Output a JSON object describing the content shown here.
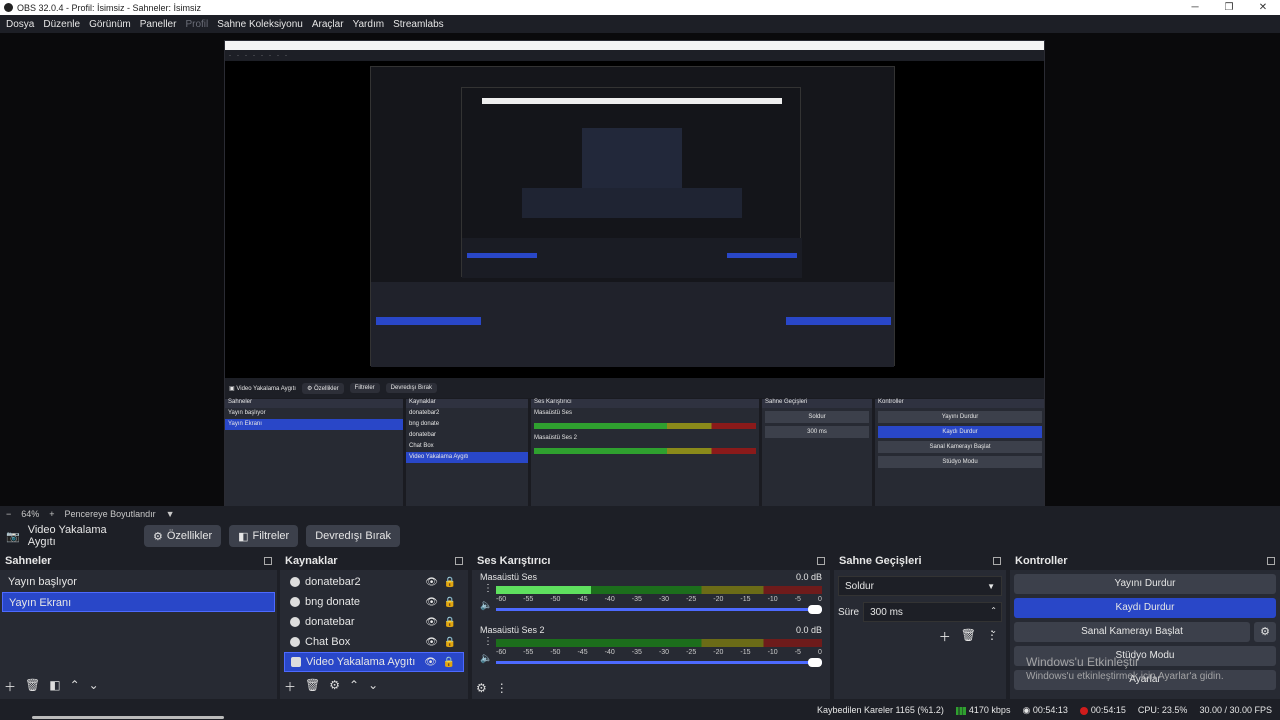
{
  "window": {
    "title": "OBS 32.0.4 - Profil: İsimsiz - Sahneler: İsimsiz"
  },
  "menu": [
    "Dosya",
    "Düzenle",
    "Görünüm",
    "Paneller",
    "Profil",
    "Sahne Koleksiyonu",
    "Araçlar",
    "Yardım",
    "Streamlabs"
  ],
  "zoom": {
    "minus": "−",
    "value": "64%",
    "plus": "+",
    "fit_label": "Pencereye Boyutlandır"
  },
  "source_bar": {
    "source_name": "Video Yakalama Aygıtı",
    "properties": "Özellikler",
    "filters": "Filtreler",
    "deactivate": "Devredışı Bırak"
  },
  "scenes": {
    "title": "Sahneler",
    "items": [
      "Yayın başlıyor",
      "Yayın Ekranı"
    ],
    "selected_index": 1
  },
  "sources": {
    "title": "Kaynaklar",
    "items": [
      "donatebar2",
      "bng donate",
      "donatebar",
      "Chat Box",
      "Video Yakalama Aygıtı"
    ],
    "selected_index": 4
  },
  "mixer": {
    "title": "Ses Karıştırıcı",
    "channels": [
      {
        "name": "Masaüstü Ses",
        "db": "0.0 dB",
        "level": 0.29
      },
      {
        "name": "Masaüstü Ses 2",
        "db": "0.0 dB",
        "level": 0
      }
    ],
    "ticks": [
      "-60",
      "-55",
      "-50",
      "-45",
      "-40",
      "-35",
      "-30",
      "-25",
      "-20",
      "-15",
      "-10",
      "-5",
      "0"
    ]
  },
  "transitions": {
    "title": "Sahne Geçişleri",
    "selected": "Soldur",
    "duration_label": "Süre",
    "duration_value": "300 ms"
  },
  "controls": {
    "title": "Kontroller",
    "stop_stream": "Yayını Durdur",
    "stop_recording": "Kaydı Durdur",
    "virtual_cam": "Sanal Kamerayı Başlat",
    "studio_mode": "Stüdyo Modu",
    "settings": "Ayarlar"
  },
  "watermark": {
    "line1": "Windows'u Etkinleştir",
    "line2": "Windows'u etkinleştirmek için Ayarlar'a gidin."
  },
  "status": {
    "dropped": "Kaybedilen Kareler 1165 (%1.2)",
    "bitrate": "4170 kbps",
    "stream_time": "00:54:13",
    "rec_time": "00:54:15",
    "cpu": "CPU: 23.5%",
    "fps": "30.00 / 30.00 FPS"
  },
  "colors": {
    "accent": "#2947c8",
    "bg": "#1d1f26",
    "dock": "#272a33",
    "record": "#d01c1c"
  }
}
